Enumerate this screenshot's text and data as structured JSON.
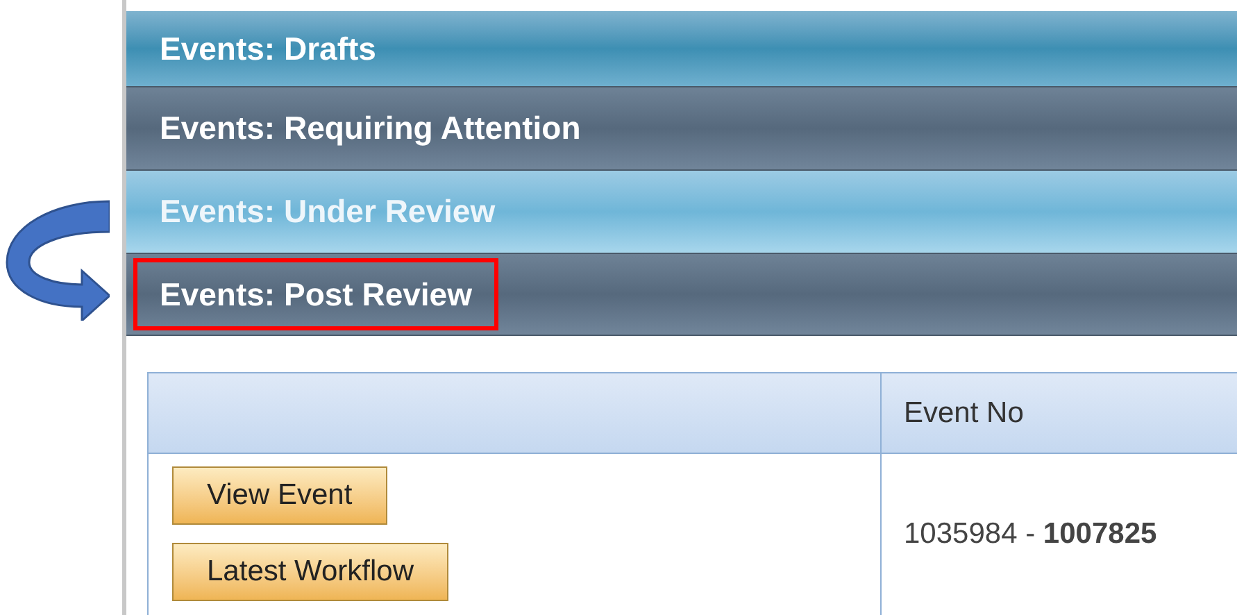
{
  "panels": [
    {
      "label": "Events: Drafts",
      "kind": "light",
      "highlighted": false
    },
    {
      "label": "Events: Requiring Attention",
      "kind": "dark",
      "highlighted": false
    },
    {
      "label": "Events: Under Review",
      "kind": "pale",
      "highlighted": false
    },
    {
      "label": "Events: Post Review",
      "kind": "dark",
      "highlighted": true
    }
  ],
  "table": {
    "columns": [
      "",
      "Event No"
    ],
    "rows": [
      {
        "buttons": [
          "View Event",
          "Latest Workflow"
        ],
        "event_no": "1035984 - **1007825**"
      }
    ]
  }
}
